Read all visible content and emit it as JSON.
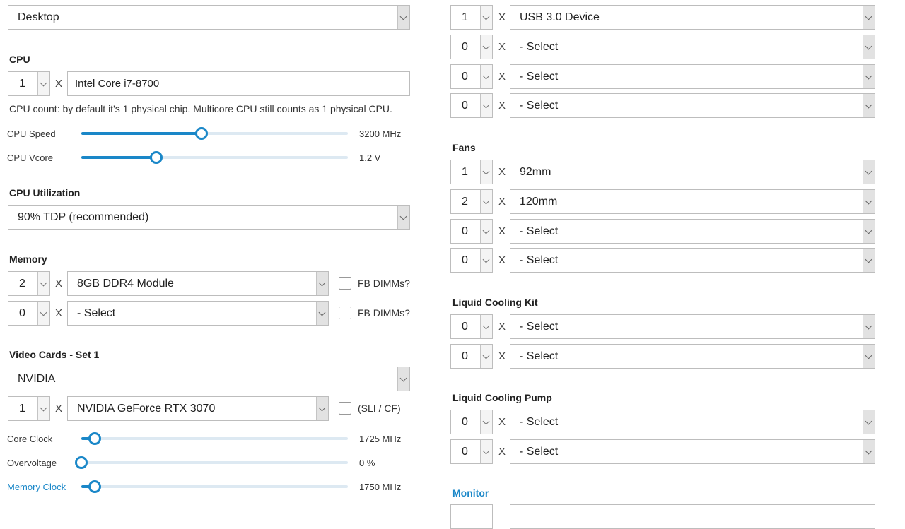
{
  "system_type": "Desktop",
  "cpu": {
    "heading": "CPU",
    "qty": "1",
    "x": "X",
    "model": "Intel Core i7-8700",
    "note": "CPU count: by default it's 1 physical chip. Multicore CPU still counts as 1 physical CPU.",
    "speed": {
      "label": "CPU Speed",
      "value": "3200 MHz",
      "fraction": 0.45
    },
    "vcore": {
      "label": "CPU Vcore",
      "value": "1.2 V",
      "fraction": 0.28
    }
  },
  "cpu_util": {
    "heading": "CPU Utilization",
    "value": "90% TDP (recommended)"
  },
  "memory": {
    "heading": "Memory",
    "rows": [
      {
        "qty": "2",
        "x": "X",
        "module": "8GB DDR4 Module",
        "fb_label": "FB DIMMs?"
      },
      {
        "qty": "0",
        "x": "X",
        "module": "- Select",
        "fb_label": "FB DIMMs?"
      }
    ]
  },
  "video": {
    "heading": "Video Cards - Set 1",
    "brand": "NVIDIA",
    "qty": "1",
    "x": "X",
    "model": "NVIDIA GeForce RTX 3070",
    "sli_label": "(SLI / CF)",
    "core_clock": {
      "label": "Core Clock",
      "value": "1725 MHz",
      "fraction": 0.05
    },
    "overvoltage": {
      "label": "Overvoltage",
      "value": "0 %",
      "fraction": 0.0
    },
    "memory_clock": {
      "label": "Memory Clock",
      "value": "1750 MHz",
      "fraction": 0.05
    }
  },
  "usb": {
    "rows": [
      {
        "qty": "1",
        "x": "X",
        "device": "USB 3.0 Device"
      },
      {
        "qty": "0",
        "x": "X",
        "device": "- Select"
      },
      {
        "qty": "0",
        "x": "X",
        "device": "- Select"
      },
      {
        "qty": "0",
        "x": "X",
        "device": "- Select"
      }
    ]
  },
  "fans": {
    "heading": "Fans",
    "rows": [
      {
        "qty": "1",
        "x": "X",
        "device": "92mm"
      },
      {
        "qty": "2",
        "x": "X",
        "device": "120mm"
      },
      {
        "qty": "0",
        "x": "X",
        "device": "- Select"
      },
      {
        "qty": "0",
        "x": "X",
        "device": "- Select"
      }
    ]
  },
  "liquid_kit": {
    "heading": "Liquid Cooling Kit",
    "rows": [
      {
        "qty": "0",
        "x": "X",
        "device": "- Select"
      },
      {
        "qty": "0",
        "x": "X",
        "device": "- Select"
      }
    ]
  },
  "liquid_pump": {
    "heading": "Liquid Cooling Pump",
    "rows": [
      {
        "qty": "0",
        "x": "X",
        "device": "- Select"
      },
      {
        "qty": "0",
        "x": "X",
        "device": "- Select"
      }
    ]
  },
  "monitor": {
    "heading": "Monitor"
  },
  "colors": {
    "accent": "#1a87c8",
    "slider_track": "#dde9f2"
  }
}
